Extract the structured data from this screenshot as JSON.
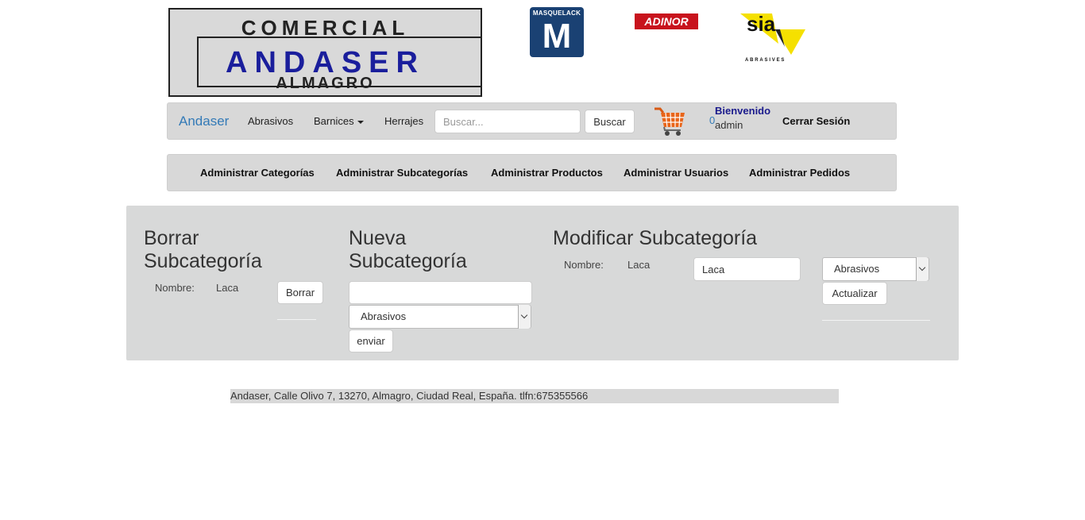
{
  "logos": {
    "main": {
      "line1": "COMERCIAL",
      "line2": "ANDASER",
      "line3": "ALMAGRO"
    },
    "masquelack": {
      "label": "MASQUELACK",
      "letter": "M",
      "color": "#1a4173"
    },
    "adinor": {
      "label": "ADINOR S.L.",
      "color": "#c8131d"
    },
    "sia": {
      "label": "sia",
      "sub": "ABRASIVES",
      "color": "#f5e000"
    }
  },
  "navbar": {
    "brand": "Andaser",
    "links": [
      "Abrasivos",
      "Barnices",
      "Herrajes"
    ],
    "search_placeholder": "Buscar...",
    "search_button": "Buscar",
    "cart_icon": "shopping-cart-icon",
    "cart_count": "0",
    "welcome": "Bienvenido",
    "username": "admin",
    "logout": "Cerrar Sesión"
  },
  "admin_menu": {
    "items": [
      "Administrar Categorías",
      "Administrar Subcategorías",
      "Administrar Productos",
      "Administrar Usuarios",
      "Administrar Pedidos"
    ]
  },
  "borrar": {
    "title_line1": "Borrar",
    "title_line2": "Subcategoría",
    "name_label": "Nombre:",
    "name_value": "Laca",
    "button": "Borrar"
  },
  "nueva": {
    "title_line1": "Nueva",
    "title_line2": "Subcategoría",
    "input_value": "",
    "select_value": "Abrasivos",
    "button": "enviar"
  },
  "modificar": {
    "title": "Modificar Subcategoría",
    "name_label": "Nombre:",
    "name_value": "Laca",
    "input_value": "Laca",
    "select_value": "Abrasivos",
    "button": "Actualizar"
  },
  "footer": {
    "text": "Andaser, Calle Olivo 7, 13270, Almagro, Ciudad Real, España. tlfn:675355566"
  },
  "colors": {
    "bar_bg": "#d8d8d8",
    "brand_link": "#337ab7",
    "welcome": "#1a1a8c"
  }
}
